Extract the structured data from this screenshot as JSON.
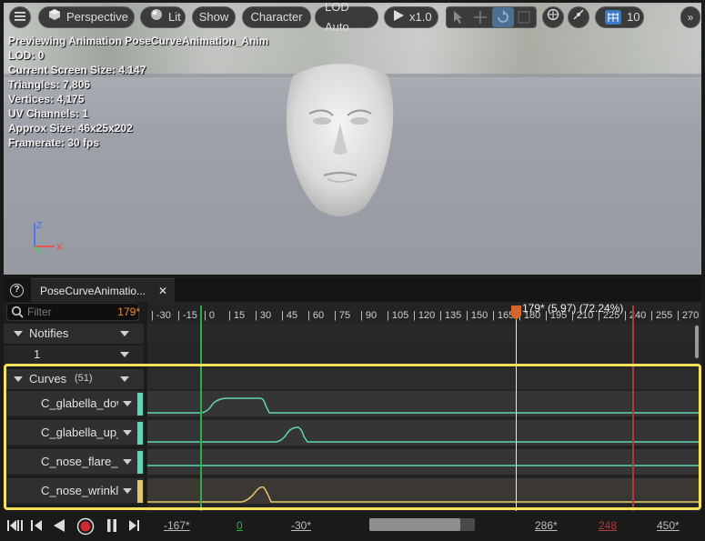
{
  "toolbar": {
    "perspective": "Perspective",
    "lit": "Lit",
    "show": "Show",
    "character": "Character",
    "lod": "LOD Auto",
    "play_speed": "x1.0",
    "grid_snap": "10"
  },
  "stats": {
    "line1": "Previewing Animation PoseCurveAnimation_Anim",
    "line2": "LOD: 0",
    "line3": "Current Screen Size: 4.147",
    "line4": "Triangles: 7,806",
    "line5": "Vertices: 4,175",
    "line6": "UV Channels: 1",
    "line7": "Approx Size: 46x25x202",
    "line8": "Framerate: 30 fps"
  },
  "panel": {
    "tab_label": "PoseCurveAnimatio...",
    "filter_placeholder": "Filter",
    "filter_count": "179*",
    "notifies_label": "Notifies",
    "notifies_track": "1",
    "curves_label": "Curves",
    "curves_count": "(51)",
    "curves": [
      {
        "label": "C_glabella_dov",
        "color": "#5ed6b6"
      },
      {
        "label": "C_glabella_up_",
        "color": "#5ed6b6"
      },
      {
        "label": "C_nose_flare_p",
        "color": "#5ed6b6"
      },
      {
        "label": "C_nose_wrinkl",
        "color": "#e4c76b"
      }
    ],
    "playhead_label": "179* (5.97) (72.24%)",
    "ruler_ticks": [
      "-30",
      "-15",
      "0",
      "15",
      "30",
      "45",
      "60",
      "75",
      "90",
      "105",
      "120",
      "135",
      "150",
      "165",
      "180",
      "195",
      "210",
      "225",
      "240",
      "255",
      "270"
    ],
    "view_start": "-167*",
    "work_start": "0",
    "scroll_start": "-30*",
    "scroll_end": "286*",
    "work_end": "248",
    "view_end": "450*"
  },
  "colors": {
    "accent_orange": "#f08c2a",
    "selection_yellow": "#f7e05a",
    "curve_teal": "#5ed6b6",
    "curve_gold": "#e4c76b",
    "start_marker_green": "#2fae45",
    "end_marker_red": "#b33a3a"
  }
}
